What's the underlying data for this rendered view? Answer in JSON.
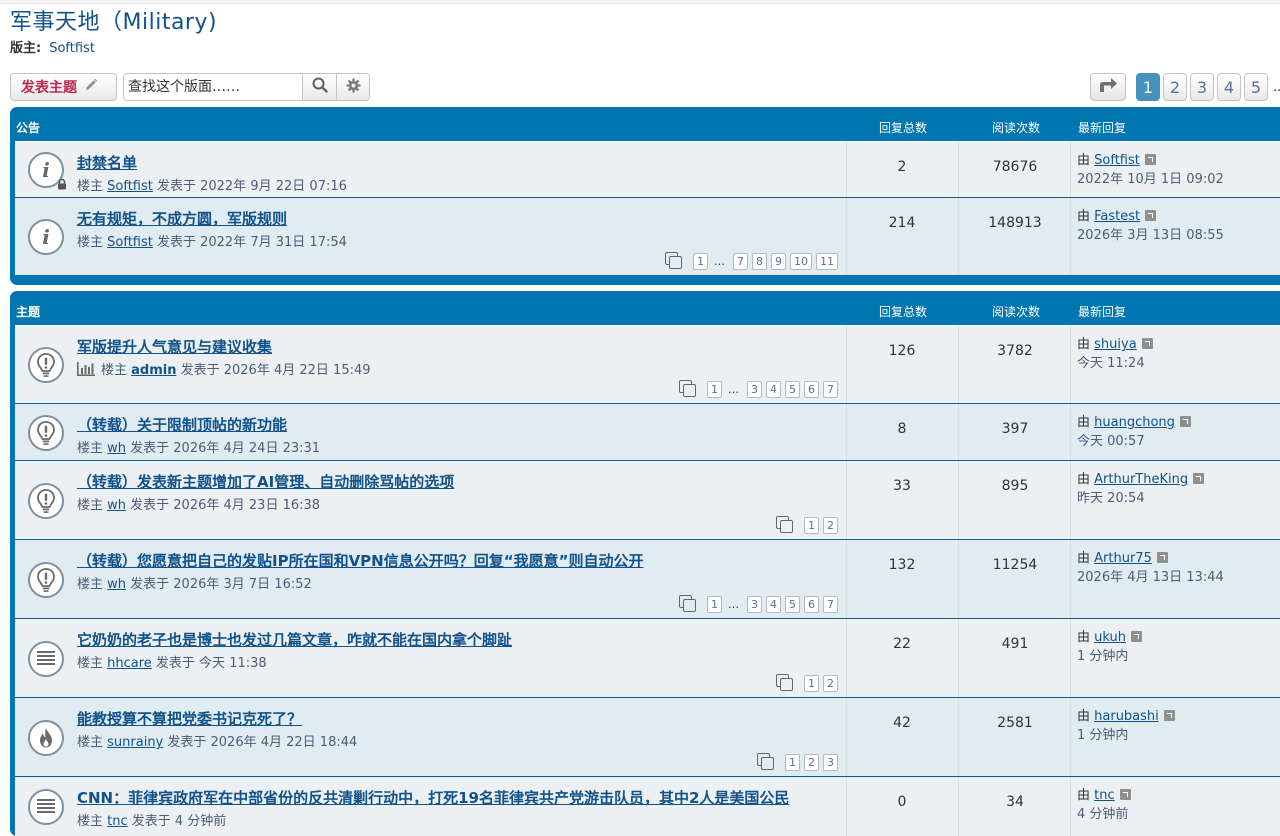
{
  "forum": {
    "title": "军事天地（Military)",
    "moderator_label": "版主:",
    "moderator_name": "Softfist"
  },
  "toolbar": {
    "post_button": "发表主题",
    "search_placeholder": "查找这个版面……"
  },
  "pagination": {
    "pages": [
      "1",
      "2",
      "3",
      "4",
      "5"
    ],
    "current": "1",
    "ellipsis": ".."
  },
  "announcements": {
    "header": {
      "title": "公告",
      "replies": "回复总数",
      "views": "阅读次数",
      "last_post": "最新回复"
    },
    "rows": [
      {
        "icon": "announcement-locked-icon",
        "title": "封禁名单",
        "meta_prefix": "楼主 ",
        "author": "Softfist",
        "meta_suffix": " 发表于 2022年 9月 22日 07:16",
        "replies": "2",
        "views": "78676",
        "last_by_prefix": "由 ",
        "last_by": "Softfist",
        "last_time": "2022年 10月 1日 09:02",
        "pages": []
      },
      {
        "icon": "announcement-icon",
        "title": "无有规矩，不成方圆，军版规则",
        "meta_prefix": "楼主 ",
        "author": "Softfist",
        "meta_suffix": " 发表于 2022年 7月 31日 17:54",
        "replies": "214",
        "views": "148913",
        "last_by_prefix": "由 ",
        "last_by": "Fastest",
        "last_time": "2026年 3月 13日 08:55",
        "pages": [
          "1",
          "…",
          "7",
          "8",
          "9",
          "10",
          "11"
        ]
      }
    ]
  },
  "topics": {
    "header": {
      "title": "主题",
      "replies": "回复总数",
      "views": "阅读次数",
      "last_post": "最新回复"
    },
    "rows": [
      {
        "icon": "sticky-topic-icon",
        "title": "军版提升人气意见与建议收集",
        "poll": true,
        "meta_prefix": "楼主 ",
        "author": "admin",
        "meta_suffix": " 发表于 2026年 4月 22日 15:49",
        "replies": "126",
        "views": "3782",
        "last_by_prefix": "由 ",
        "last_by": "shuiya",
        "last_time": "今天 11:24",
        "pages": [
          "1",
          "…",
          "3",
          "4",
          "5",
          "6",
          "7"
        ]
      },
      {
        "icon": "sticky-topic-icon",
        "title": "（转载）关于限制顶帖的新功能",
        "meta_prefix": "楼主 ",
        "author": "wh",
        "meta_suffix": " 发表于 2026年 4月 24日 23:31",
        "replies": "8",
        "views": "397",
        "last_by_prefix": "由 ",
        "last_by": "huangchong",
        "last_time": "今天 00:57",
        "pages": []
      },
      {
        "icon": "sticky-topic-icon",
        "title": "（转载）发表新主题增加了AI管理、自动删除骂帖的选项",
        "meta_prefix": "楼主 ",
        "author": "wh",
        "meta_suffix": " 发表于 2026年 4月 23日 16:38",
        "replies": "33",
        "views": "895",
        "last_by_prefix": "由 ",
        "last_by": "ArthurTheKing",
        "last_time": "昨天 20:54",
        "pages": [
          "1",
          "2"
        ]
      },
      {
        "icon": "sticky-topic-icon",
        "title": "（转载）您愿意把自己的发贴IP所在国和VPN信息公开吗？回复“我愿意”则自动公开",
        "meta_prefix": "楼主 ",
        "author": "wh",
        "meta_suffix": " 发表于 2026年 3月 7日 16:52",
        "replies": "132",
        "views": "11254",
        "last_by_prefix": "由 ",
        "last_by": "Arthur75",
        "last_time": "2026年 4月 13日 13:44",
        "pages": [
          "1",
          "…",
          "3",
          "4",
          "5",
          "6",
          "7"
        ]
      },
      {
        "icon": "topic-icon",
        "title": "它奶奶的老子也是博士也发过几篇文章，咋就不能在国内拿个脚趾",
        "meta_prefix": "楼主 ",
        "author": "hhcare",
        "meta_suffix": " 发表于 今天 11:38",
        "replies": "22",
        "views": "491",
        "last_by_prefix": "由 ",
        "last_by": "ukuh",
        "last_time": "1 分钟内",
        "pages": [
          "1",
          "2"
        ]
      },
      {
        "icon": "hot-topic-icon",
        "title": "能教授算不算把党委书记克死了？",
        "meta_prefix": "楼主 ",
        "author": "sunrainy",
        "meta_suffix": " 发表于 2026年 4月 22日 18:44",
        "replies": "42",
        "views": "2581",
        "last_by_prefix": "由 ",
        "last_by": "harubashi",
        "last_time": "1 分钟内",
        "pages": [
          "1",
          "2",
          "3"
        ]
      },
      {
        "icon": "topic-icon",
        "title": "CNN：菲律宾政府军在中部省份的反共清剿行动中，打死19名菲律宾共产党游击队员，其中2人是美国公民",
        "meta_prefix": "楼主 ",
        "author": "tnc",
        "meta_suffix": " 发表于 4 分钟前",
        "replies": "0",
        "views": "34",
        "last_by_prefix": "由 ",
        "last_by": "tnc",
        "last_time": "4 分钟前",
        "pages": []
      }
    ]
  }
}
